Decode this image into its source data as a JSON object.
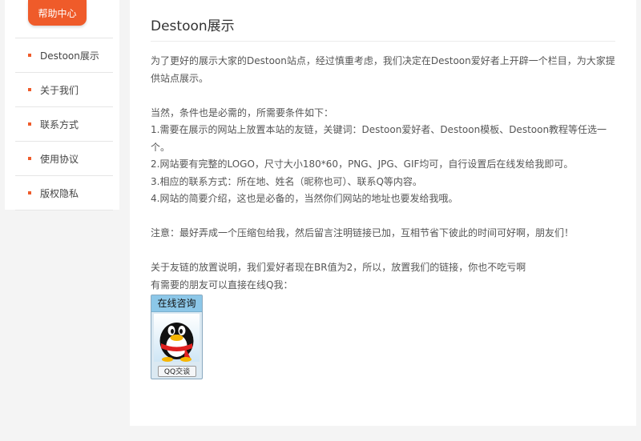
{
  "sidebar": {
    "tab_label": "帮助中心",
    "items": [
      {
        "label": "Destoon展示"
      },
      {
        "label": "关于我们"
      },
      {
        "label": "联系方式"
      },
      {
        "label": "使用协议"
      },
      {
        "label": "版权隐私"
      }
    ]
  },
  "main": {
    "title": "Destoon展示",
    "paragraphs": [
      "为了更好的展示大家的Destoon站点，经过慎重考虑，我们决定在Destoon爱好者上开辟一个栏目，为大家提供站点展示。",
      "当然，条件也是必需的，所需要条件如下：",
      "1.需要在展示的网站上放置本站的友链，关键词：Destoon爱好者、Destoon模板、Destoon教程等任选一个。",
      "2.网站要有完整的LOGO，尺寸大小180*60，PNG、JPG、GIF均可，自行设置后在线发给我即可。",
      "3.相应的联系方式：所在地、姓名（昵称也可）、联系Q等内容。",
      "4.网站的简要介绍，这也是必备的，当然你们网站的地址也要发给我哦。",
      "注意：最好弄成一个压缩包给我，然后留言注明链接已加，互相节省下彼此的时间可好啊，朋友们！",
      "关于友链的放置说明，我们爱好者现在BR值为2，所以，放置我们的链接，你也不吃亏啊",
      "有需要的朋友可以直接在线Q我："
    ],
    "qq_widget": {
      "header": "在线咨询",
      "button": "QQ交谈"
    }
  },
  "colors": {
    "accent": "#ef5b2a",
    "widget_header": "#8cc7e8"
  }
}
